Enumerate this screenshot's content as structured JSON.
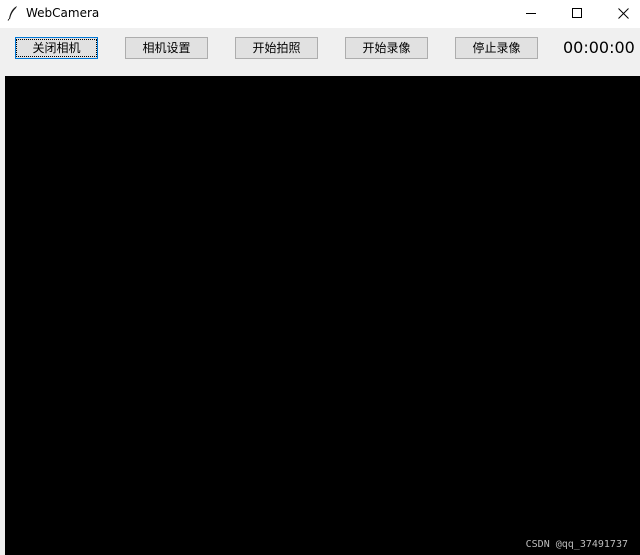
{
  "window": {
    "title": "WebCamera",
    "app_icon": "feather-icon",
    "controls": {
      "minimize_icon": "minimize-icon",
      "maximize_icon": "maximize-icon",
      "close_icon": "close-icon"
    }
  },
  "toolbar": {
    "buttons": [
      {
        "label": "关闭相机",
        "focused": true
      },
      {
        "label": "相机设置"
      },
      {
        "label": "开始拍照"
      },
      {
        "label": "开始录像"
      },
      {
        "label": "停止录像"
      }
    ],
    "timer": "00:00:00"
  },
  "video": {
    "background": "#000000",
    "watermark": "CSDN @qq_37491737"
  }
}
